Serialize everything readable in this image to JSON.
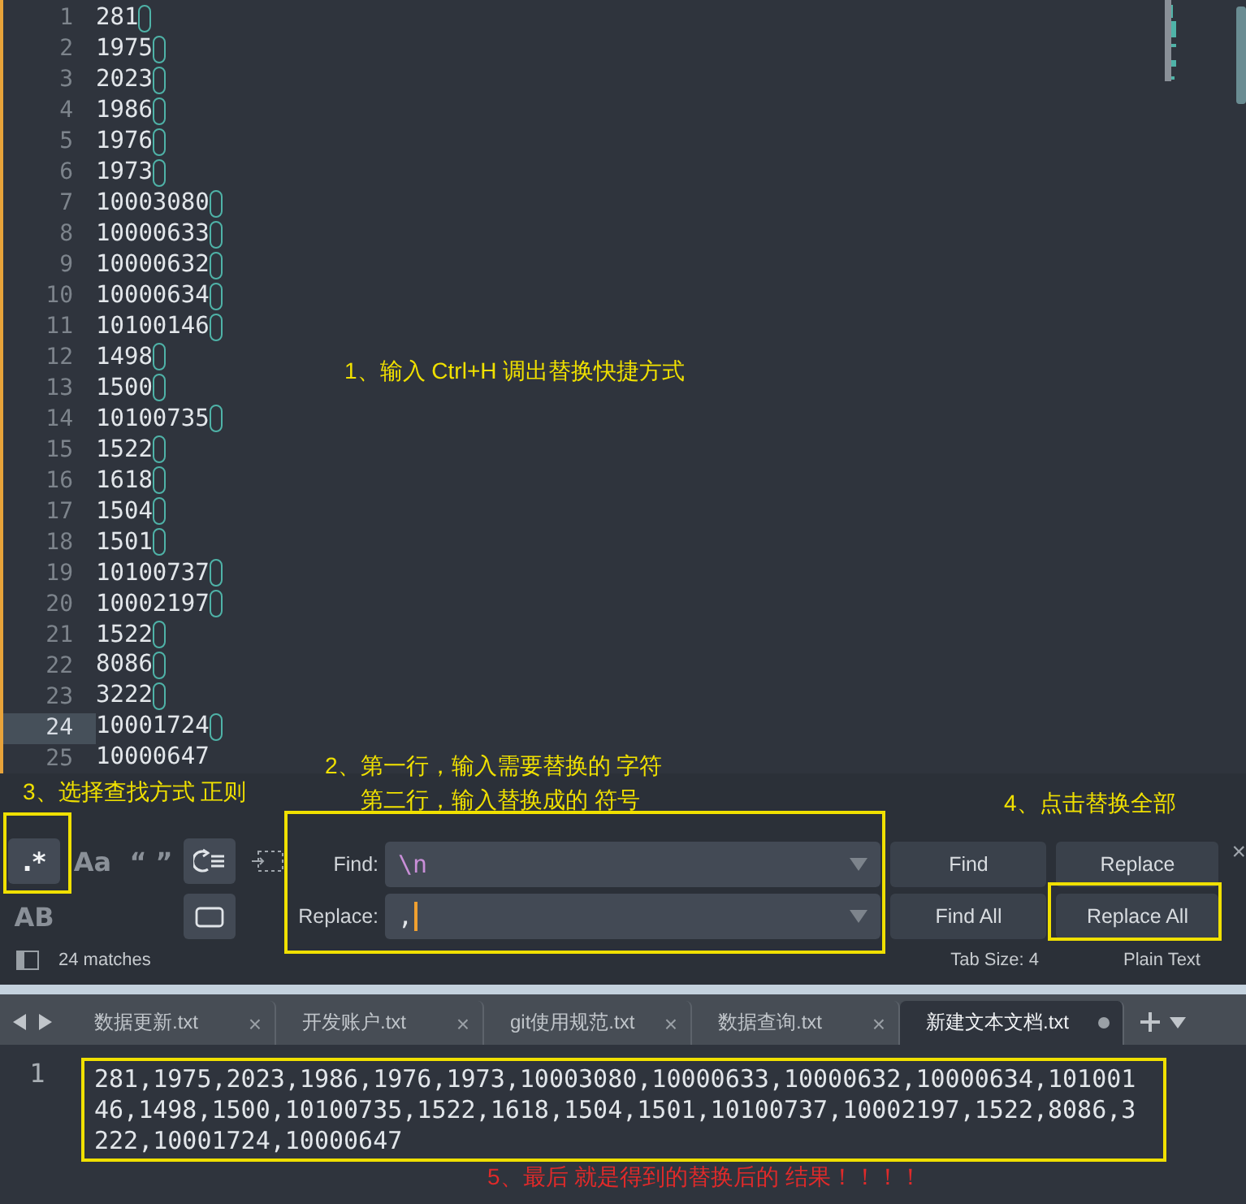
{
  "editor": {
    "lines": [
      {
        "number": "1",
        "text": "281",
        "match": true,
        "current": false
      },
      {
        "number": "2",
        "text": "1975",
        "match": true,
        "current": false
      },
      {
        "number": "3",
        "text": "2023",
        "match": true,
        "current": false
      },
      {
        "number": "4",
        "text": "1986",
        "match": true,
        "current": false
      },
      {
        "number": "5",
        "text": "1976",
        "match": true,
        "current": false
      },
      {
        "number": "6",
        "text": "1973",
        "match": true,
        "current": false
      },
      {
        "number": "7",
        "text": "10003080",
        "match": true,
        "current": false
      },
      {
        "number": "8",
        "text": "10000633",
        "match": true,
        "current": false
      },
      {
        "number": "9",
        "text": "10000632",
        "match": true,
        "current": false
      },
      {
        "number": "10",
        "text": "10000634",
        "match": true,
        "current": false
      },
      {
        "number": "11",
        "text": "10100146",
        "match": true,
        "current": false
      },
      {
        "number": "12",
        "text": "1498",
        "match": true,
        "current": false
      },
      {
        "number": "13",
        "text": "1500",
        "match": true,
        "current": false
      },
      {
        "number": "14",
        "text": "10100735",
        "match": true,
        "current": false
      },
      {
        "number": "15",
        "text": "1522",
        "match": true,
        "current": false
      },
      {
        "number": "16",
        "text": "1618",
        "match": true,
        "current": false
      },
      {
        "number": "17",
        "text": "1504",
        "match": true,
        "current": false
      },
      {
        "number": "18",
        "text": "1501",
        "match": true,
        "current": false
      },
      {
        "number": "19",
        "text": "10100737",
        "match": true,
        "current": false
      },
      {
        "number": "20",
        "text": "10002197",
        "match": true,
        "current": false
      },
      {
        "number": "21",
        "text": "1522",
        "match": true,
        "current": false
      },
      {
        "number": "22",
        "text": "8086",
        "match": true,
        "current": false
      },
      {
        "number": "23",
        "text": "3222",
        "match": true,
        "current": false
      },
      {
        "number": "24",
        "text": "10001724",
        "match": true,
        "current": true
      },
      {
        "number": "25",
        "text": "10000647",
        "match": false,
        "current": false
      }
    ]
  },
  "annotations": [
    "1、输入 Ctrl+H 调出替换快捷方式",
    "2、第一行，输入需要替换的 字符",
    "3、选择查找方式 正则",
    "第二行，输入替换成的 符号",
    "4、点击替换全部",
    "5、最后 就是得到的替换后的 结果！！！！"
  ],
  "find_panel": {
    "options": [
      {
        "kind": "text",
        "label": ".*",
        "selected": true
      },
      {
        "kind": "text",
        "label": "Aa",
        "selected": false
      },
      {
        "kind": "text",
        "label": "“ ”",
        "selected": false
      },
      {
        "kind": "wrap",
        "selected": true
      },
      {
        "kind": "selection",
        "selected": false
      },
      {
        "kind": "text",
        "label": "AB",
        "selected": false
      },
      {
        "kind": "highlight",
        "selected": true
      }
    ],
    "find": {
      "label": "Find:",
      "value": "\\n"
    },
    "replace": {
      "label": "Replace:",
      "value": ","
    },
    "buttons": [
      "Find",
      "Replace",
      "Find All",
      "Replace All"
    ],
    "close": "×"
  },
  "status_bar": {
    "matches": "24 matches",
    "tab_size": "Tab Size: 4",
    "syntax": "Plain Text"
  },
  "tabs": [
    {
      "label": "数据更新.txt",
      "selected": false,
      "modified": false,
      "close": "×"
    },
    {
      "label": "开发账户.txt",
      "selected": false,
      "modified": false,
      "close": "×"
    },
    {
      "label": "git使用规范.txt",
      "selected": false,
      "modified": false,
      "close": "×"
    },
    {
      "label": "数据查询.txt",
      "selected": false,
      "modified": false,
      "close": "×"
    },
    {
      "label": "新建文本文档.txt",
      "selected": true,
      "modified": true
    }
  ],
  "result": {
    "number": "1",
    "text": "281,1975,2023,1986,1976,1973,10003080,10000633,10000632,10000634,10100146,1498,1500,10100735,1522,1618,1504,1501,10100737,10002197,1522,8086,3222,10001724,10000647"
  }
}
